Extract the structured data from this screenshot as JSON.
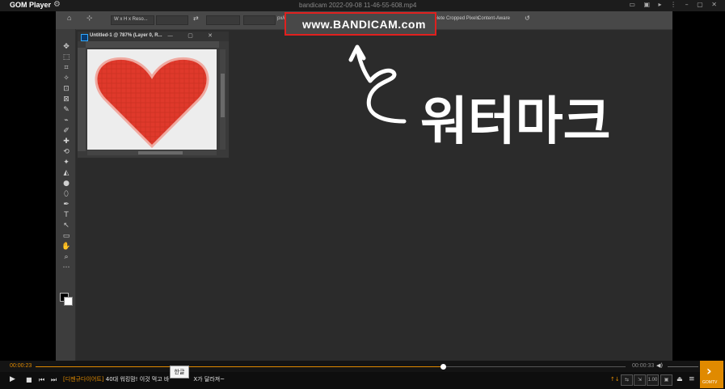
{
  "player": {
    "brand": "GOM Player",
    "file_title": "bandicam 2022-09-08 11-46-55-608.mp4",
    "window_buttons": "▭ ▣ ▸ ⋮ – ▢ ✕"
  },
  "options_bar": {
    "size_select": "W x H x Reso...",
    "ratio_label": "px/in",
    "delete_cropped": "Delete Cropped Pixels",
    "content_aware": "Content-Aware"
  },
  "document": {
    "name": "Untitled-1 @ 787% (Layer 0, R...",
    "ps_icon": "ps-document-icon",
    "buttons": "— ▢ ✕"
  },
  "watermark": {
    "text": "www.BANDICAM.com"
  },
  "annotation": {
    "text": "워터마크",
    "color": "#ffffff"
  },
  "playback": {
    "time_current": "00:00:23",
    "time_total": "00:00:33",
    "progress": 0.69,
    "accent": "#e08a00"
  },
  "ticker": {
    "tag": "[디젠규다이어트]",
    "text": "40대 워킹맘! 이것 먹고 바",
    "text2": "X가 달라져~"
  },
  "ime": {
    "label": "한글"
  },
  "right_controls": {
    "sort_icon": "↑↓",
    "btn1": "⇆",
    "btn2": "⇲",
    "speed": "1.00",
    "btn4": "▣",
    "eject": "⏏",
    "menu": "≡"
  },
  "gomtv": {
    "label": "GOMTV"
  },
  "tools": [
    "✥",
    "⬚",
    "⌗",
    "✧",
    "⊡",
    "⊠",
    "✎",
    "⌁",
    "✐",
    "✚",
    "⟲",
    "✦",
    "◭",
    "●",
    "⬯",
    "✒",
    "T",
    "↖",
    "▭",
    "✋",
    "⌕",
    "⋯"
  ]
}
